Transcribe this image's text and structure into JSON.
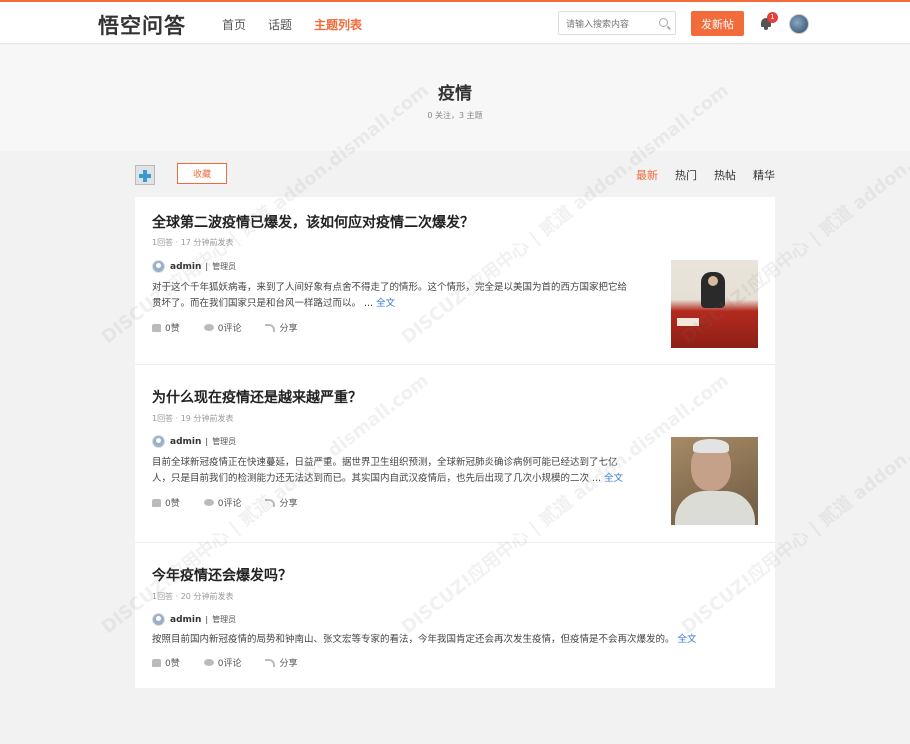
{
  "header": {
    "logo": "悟空问答",
    "nav": [
      "首页",
      "话题",
      "主题列表"
    ],
    "active_nav": "主题列表",
    "search_placeholder": "请输入搜索内容",
    "post_button": "发新帖",
    "notification_count": "1"
  },
  "topic": {
    "title": "疫情",
    "meta": "0 关注，3 主题"
  },
  "toolbar": {
    "favorite": "收藏",
    "tabs": [
      "最新",
      "热门",
      "热帖",
      "精华"
    ],
    "active_tab": "最新"
  },
  "posts": [
    {
      "title": "全球第二波疫情已爆发，该如何应对疫情二次爆发？",
      "meta": "1回答 · 17 分钟前发表",
      "author": "admin",
      "role": "管理员",
      "excerpt_line1": "对于这个千年狐妖病毒，来到了人间好象有点舍不得走了的情形。这个情形，完全是以美国为首的西方国家把它给",
      "excerpt_line2": "贯坏了。而在我们国家只是和台风一样路过而以。 ...",
      "more": "全文",
      "likes": "0赞",
      "comments": "0评论",
      "share": "分享"
    },
    {
      "title": "为什么现在疫情还是越来越严重？",
      "meta": "1回答 · 19 分钟前发表",
      "author": "admin",
      "role": "管理员",
      "excerpt_line1": "目前全球新冠疫情正在快速蔓延，日益严重。据世界卫生组织预测，全球新冠肺炎确诊病例可能已经达到了七亿",
      "excerpt_line2": "人，只是目前我们的检测能力还无法达到而已。其实国内自武汉疫情后，也先后出现了几次小规模的二次 ...",
      "more": "全文",
      "likes": "0赞",
      "comments": "0评论",
      "share": "分享"
    },
    {
      "title": "今年疫情还会爆发吗？",
      "meta": "1回答 · 20 分钟前发表",
      "author": "admin",
      "role": "管理员",
      "excerpt_line1": "按照目前国内新冠疫情的局势和钟南山、张文宏等专家的看法，今年我国肯定还会再次发生疫情，但疫情是不会再次爆发的。",
      "more": "全文",
      "likes": "0赞",
      "comments": "0评论",
      "share": "分享"
    }
  ],
  "watermark": "DISCUZ!应用中心 | 贰道 addon.dismall.com"
}
